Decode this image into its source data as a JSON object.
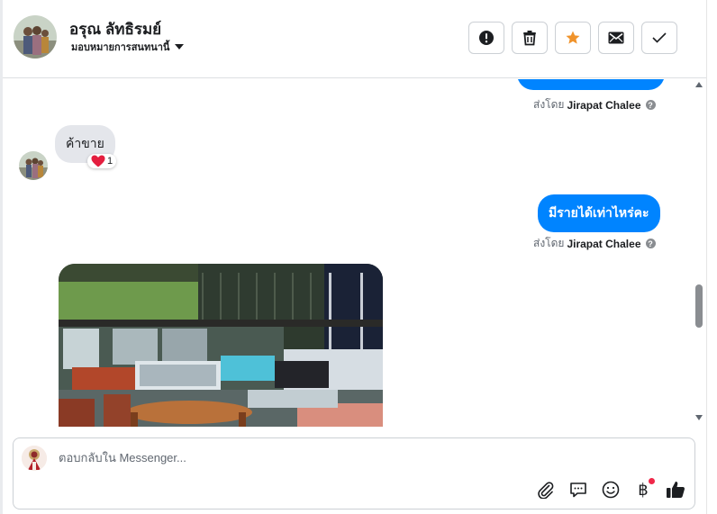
{
  "header": {
    "contact_name": "อรุณ ลัทธิรมย์",
    "assign_label": "มอบหมายการสนทนานี้",
    "toolbar": [
      {
        "name": "report-button",
        "icon": "exclamation-icon"
      },
      {
        "name": "delete-button",
        "icon": "trash-icon"
      },
      {
        "name": "star-button",
        "icon": "star-icon"
      },
      {
        "name": "mark-unread-button",
        "icon": "envelope-icon"
      },
      {
        "name": "mark-done-button",
        "icon": "check-icon"
      }
    ]
  },
  "messages": {
    "sent_prefix": "ส่งโดย",
    "sender": "Jirapat Chalee",
    "incoming_text": "ค้าขาย",
    "reaction_count": "1",
    "outgoing_text": "มีรายได้เท่าไหร่คะ"
  },
  "composer": {
    "placeholder": "ตอบกลับใน Messenger...",
    "value": ""
  },
  "colors": {
    "accent": "#0084ff",
    "star": "#f0932b",
    "incoming_bubble": "#e4e6eb"
  }
}
